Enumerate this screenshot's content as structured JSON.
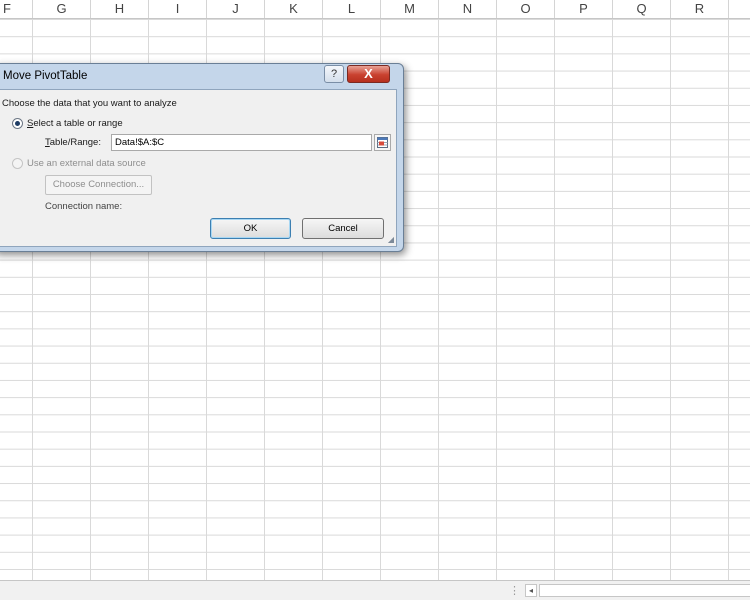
{
  "sheet": {
    "columns": [
      "F",
      "G",
      "H",
      "I",
      "J",
      "K",
      "L",
      "M",
      "N",
      "O",
      "P",
      "Q",
      "R"
    ]
  },
  "dialog": {
    "title": "Move PivotTable",
    "help_symbol": "?",
    "close_symbol": "X",
    "section_label": "Choose the data that you want to analyze",
    "option_table": {
      "access_key": "S",
      "rest": "elect a table or range"
    },
    "range_label": {
      "access_key": "T",
      "rest": "able/Range:"
    },
    "range_value": "Data!$A:$C",
    "option_external": "Use an external data source",
    "choose_connection_label": "Choose Connection...",
    "connection_name_label": "Connection name:",
    "ok_label": "OK",
    "cancel_label": "Cancel"
  },
  "icons": {
    "help": "question-mark-icon",
    "close": "close-icon",
    "collapse": "range-selector-icon",
    "scroll_left": "scroll-left-arrow-icon"
  },
  "statusbar": {
    "dots": "⋮",
    "scroll_left_symbol": "◂"
  }
}
